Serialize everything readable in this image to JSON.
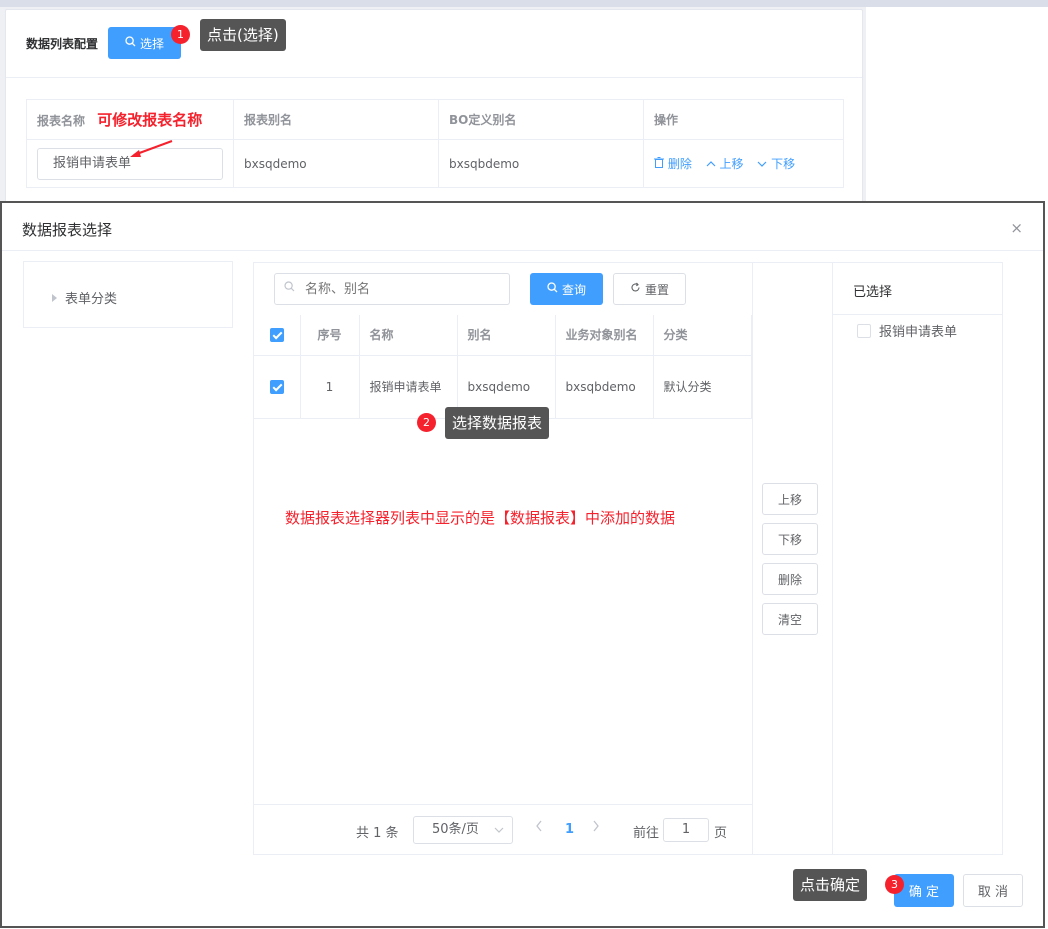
{
  "config": {
    "title": "数据列表配置",
    "select_button": "选择",
    "columns": [
      "报表名称",
      "报表别名",
      "BO定义别名",
      "操作"
    ],
    "row": {
      "name": "报销申请表单",
      "alias": "bxsqdemo",
      "bo_alias": "bxsqbdemo",
      "ops": [
        "删除",
        "上移",
        "下移"
      ]
    }
  },
  "annotations": {
    "name_note": "可修改报表名称",
    "step1_badge": "1",
    "step1_tip": "点击(选择)",
    "step2_badge": "2",
    "step2_tip": "选择数据报表",
    "list_note": "数据报表选择器列表中显示的是【数据报表】中添加的数据",
    "step3_badge": "3",
    "step3_tip": "点击确定"
  },
  "dialog": {
    "title": "数据报表选择",
    "close": "×",
    "tree_item": "表单分类",
    "search_placeholder": "名称、别名",
    "query_button": "查询",
    "reset_button": "重置",
    "columns": [
      "序号",
      "名称",
      "别名",
      "业务对象别名",
      "分类"
    ],
    "rows": [
      {
        "index": "1",
        "name": "报销申请表单",
        "alias": "bxsqdemo",
        "bo_alias": "bxsqbdemo",
        "category": "默认分类",
        "checked": true
      }
    ],
    "pager": {
      "total": "共 1 条",
      "page_size": "50条/页",
      "current": "1",
      "goto_label": "前往",
      "goto_value": "1",
      "page_label": "页"
    },
    "side_buttons": [
      "上移",
      "下移",
      "删除",
      "清空"
    ],
    "selected_title": "已选择",
    "selected_items": [
      "报销申请表单"
    ],
    "confirm": "确 定",
    "cancel": "取 消"
  },
  "colors": {
    "primary": "#409eff",
    "annotation_red": "#f5222d",
    "tooltip_bg": "#555555"
  }
}
